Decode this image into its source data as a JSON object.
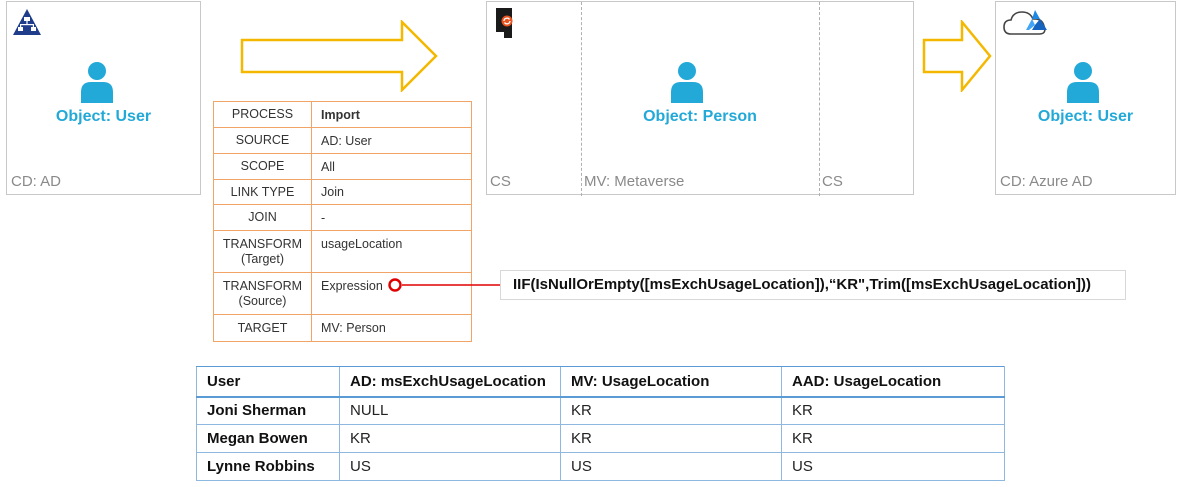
{
  "source_panel": {
    "label": "CD: AD",
    "object": "Object:  User",
    "icon": "ad-hierarchy-icon"
  },
  "sync_panel": {
    "cs_left": "CS",
    "mv_label": "MV: Metaverse",
    "cs_right": "CS",
    "object": "Object:  Person",
    "icon": "sync-server-icon"
  },
  "target_panel": {
    "label": "CD: Azure AD",
    "object": "Object:  User",
    "icon": "azure-cloud-icon"
  },
  "person_icon": "user-person-icon",
  "process": [
    {
      "key": "PROCESS",
      "value": "Import"
    },
    {
      "key": "SOURCE",
      "value": "AD: User"
    },
    {
      "key": "SCOPE",
      "value": "All"
    },
    {
      "key": "LINK TYPE",
      "value": "Join"
    },
    {
      "key": "JOIN",
      "value": "-"
    },
    {
      "key": "TRANSFORM\n(Target)",
      "value": "usageLocation"
    },
    {
      "key": "TRANSFORM\n(Source)",
      "value": "Expression"
    },
    {
      "key": "TARGET",
      "value": "MV: Person"
    }
  ],
  "expression": "IIF(IsNullOrEmpty([msExchUsageLocation]),“KR\",Trim([msExchUsageLocation]))",
  "colors": {
    "accent_blue": "#23a9d8",
    "arrow_yellow": "#f5b800",
    "table_orange": "#f0a468",
    "connector_red": "#e00000",
    "grid_blue": "#5b9bd5"
  },
  "usage_table": {
    "headers": [
      "User",
      "AD: msExchUsageLocation",
      "MV: UsageLocation",
      "AAD: UsageLocation"
    ],
    "rows": [
      [
        "Joni Sherman",
        "NULL",
        "KR",
        "KR"
      ],
      [
        "Megan Bowen",
        "KR",
        "KR",
        "KR"
      ],
      [
        "Lynne Robbins",
        "US",
        "US",
        "US"
      ]
    ]
  }
}
